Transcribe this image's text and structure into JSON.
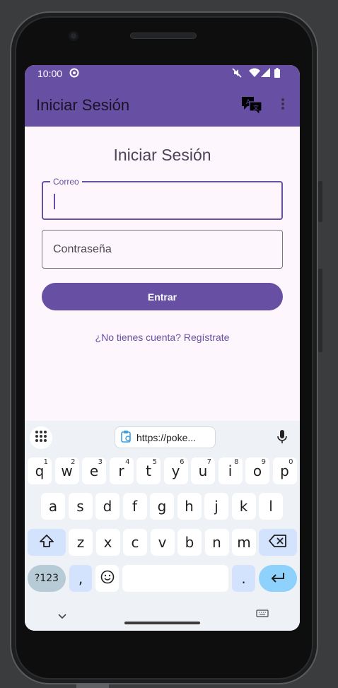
{
  "status_bar": {
    "time": "10:00"
  },
  "app_bar": {
    "title": "Iniciar Sesión"
  },
  "form": {
    "heading": "Iniciar Sesión",
    "email": {
      "label": "Correo",
      "value": ""
    },
    "password": {
      "placeholder": "Contraseña",
      "value": ""
    },
    "submit_label": "Entrar",
    "register_link": "¿No tienes cuenta? Regístrate"
  },
  "keyboard": {
    "clipboard_suggestion": "https://poke...",
    "row1": [
      {
        "key": "q",
        "hint": "1"
      },
      {
        "key": "w",
        "hint": "2"
      },
      {
        "key": "e",
        "hint": "3"
      },
      {
        "key": "r",
        "hint": "4"
      },
      {
        "key": "t",
        "hint": "5"
      },
      {
        "key": "y",
        "hint": "6"
      },
      {
        "key": "u",
        "hint": "7"
      },
      {
        "key": "i",
        "hint": "8"
      },
      {
        "key": "o",
        "hint": "9"
      },
      {
        "key": "p",
        "hint": "0"
      }
    ],
    "row2": [
      "a",
      "s",
      "d",
      "f",
      "g",
      "h",
      "j",
      "k",
      "l"
    ],
    "row3": [
      "z",
      "x",
      "c",
      "v",
      "b",
      "n",
      "m"
    ],
    "symbols_label": "?123",
    "comma": ",",
    "period": "."
  },
  "colors": {
    "primary": "#6750a4",
    "surface": "#fdf7fd",
    "keyboard_bg": "#eef1f5"
  }
}
